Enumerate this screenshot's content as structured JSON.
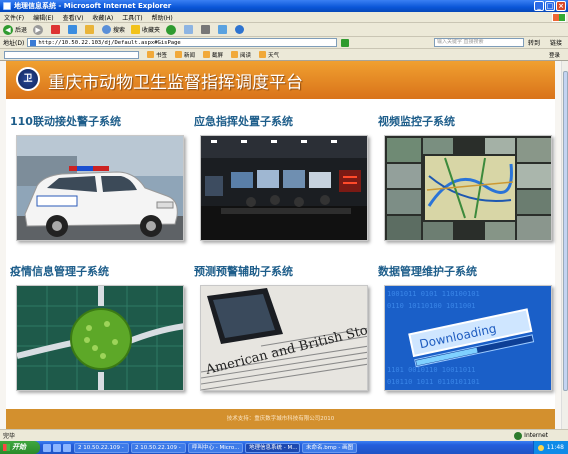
{
  "window": {
    "title": "地理信息系统 - Microsoft Internet Explorer",
    "controls": [
      "_",
      "□",
      "×"
    ]
  },
  "menu": [
    "文件(F)",
    "编辑(E)",
    "查看(V)",
    "收藏(A)",
    "工具(T)",
    "帮助(H)"
  ],
  "toolbar": {
    "back": "后退",
    "search": "搜索",
    "favorites": "收藏夹"
  },
  "address": {
    "label": "地址(D)",
    "url": "http://10.50.22.103/dj/Default.aspx#GisPage",
    "go": "转到",
    "search_placeholder": "输入关键字 直接搜索",
    "links": "链接"
  },
  "links_toolbar": {
    "items": [
      "书签",
      "新闻",
      "截屏",
      "阅读",
      "天气"
    ],
    "login": "登录"
  },
  "banner": {
    "logo_text": "卫",
    "title": "重庆市动物卫生监督指挥调度平台"
  },
  "tiles": [
    {
      "title": "110联动接处警子系统",
      "img": "police-car-image"
    },
    {
      "title": "应急指挥处置子系统",
      "img": "command-center-image"
    },
    {
      "title": "视频监控子系统",
      "img": "video-wall-image"
    },
    {
      "title": "疫情信息管理子系统",
      "img": "network-globe-image"
    },
    {
      "title": "预测预警辅助子系统",
      "img": "newspaper-stocks-image"
    },
    {
      "title": "数据管理维护子系统",
      "img": "downloading-image"
    }
  ],
  "footer": {
    "text": "技术支持：重庆数字城市科技有限公司2010"
  },
  "status": {
    "left": "完毕",
    "zone": "Internet"
  },
  "taskbar": {
    "start": "开始",
    "tasks": [
      "2 10.50.22.109 -",
      "2 10.50.22.109 -",
      "呼叫中心 - Micro...",
      "地理信息系统 - M...",
      "未命名.bmp - 画图"
    ],
    "clock": "11:48"
  },
  "image_text": {
    "downloading": "Downloading",
    "newspaper_head": "American and British Stocks"
  }
}
